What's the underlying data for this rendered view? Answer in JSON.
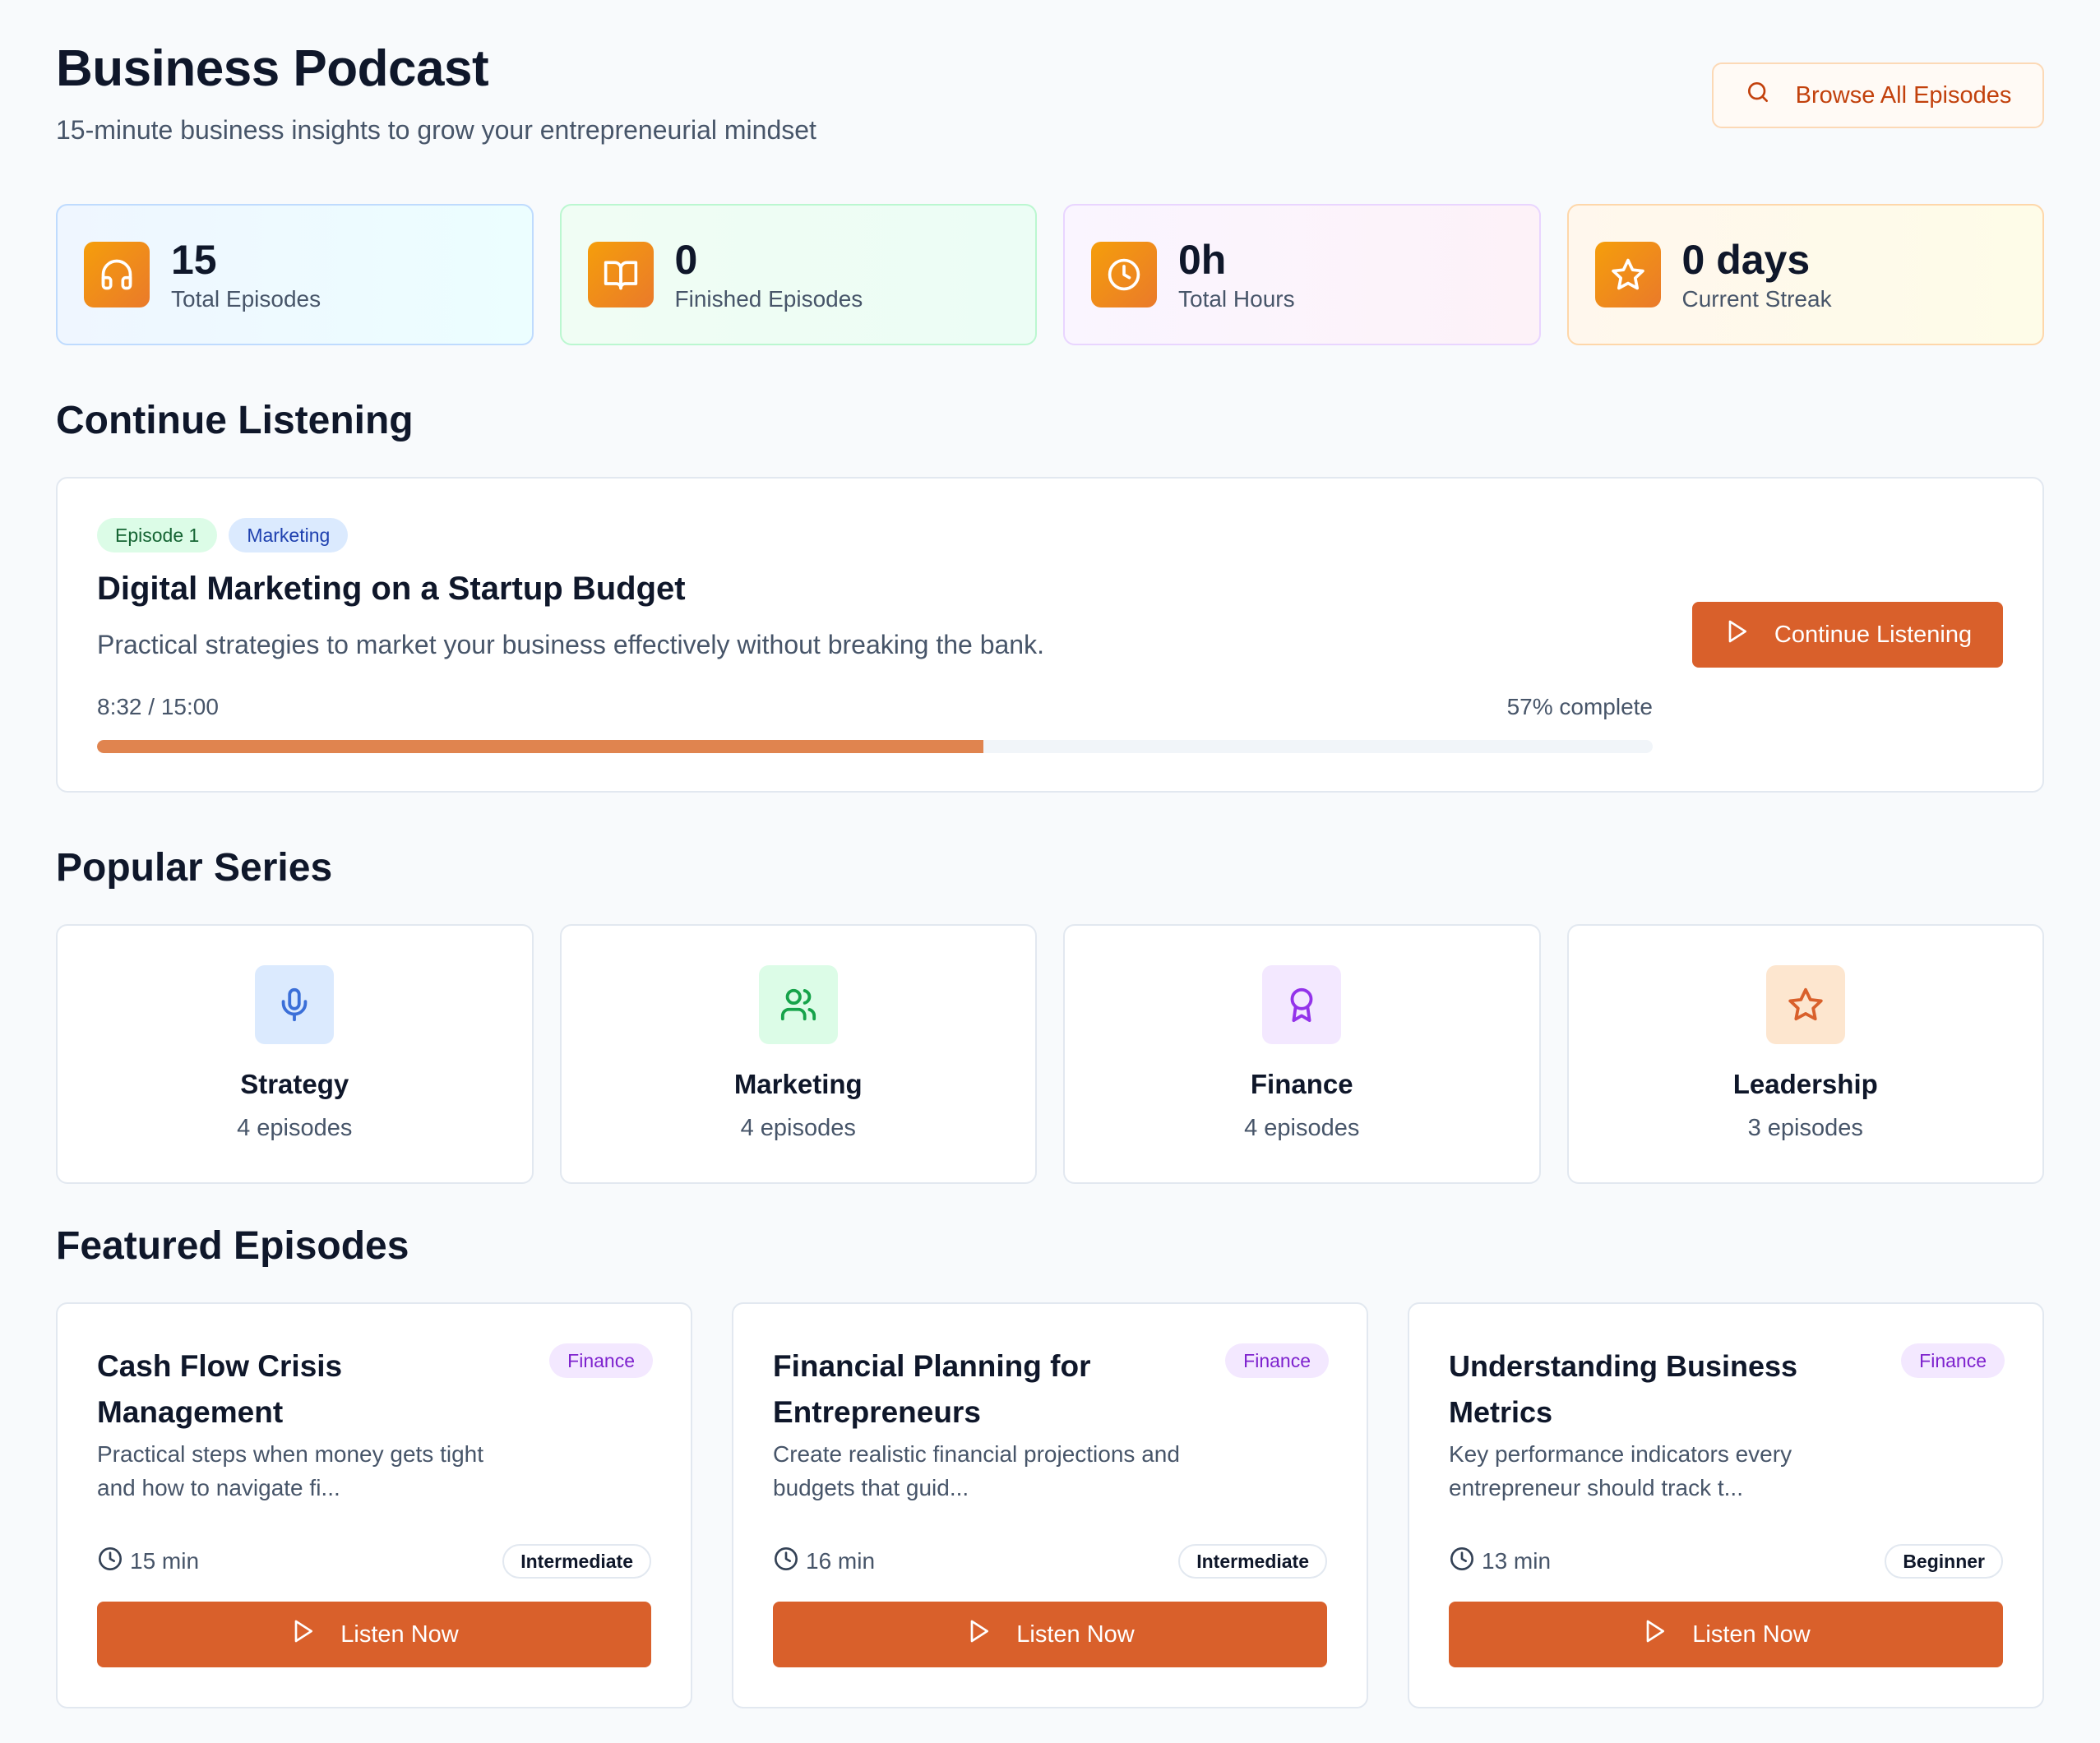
{
  "header": {
    "title": "Business Podcast",
    "subtitle": "15-minute business insights to grow your entrepreneurial mindset",
    "browse_label": "Browse All Episodes"
  },
  "stats": [
    {
      "value": "15",
      "label": "Total Episodes",
      "icon": "headphones-icon"
    },
    {
      "value": "0",
      "label": "Finished Episodes",
      "icon": "book-open-icon"
    },
    {
      "value": "0h",
      "label": "Total Hours",
      "icon": "clock-icon"
    },
    {
      "value": "0 days",
      "label": "Current Streak",
      "icon": "star-icon"
    }
  ],
  "continue_listening": {
    "section_title": "Continue Listening",
    "episode_tag": "Episode 1",
    "category_tag": "Marketing",
    "title": "Digital Marketing on a Startup Budget",
    "description": "Practical strategies to market your business effectively without breaking the bank.",
    "time": "8:32 / 15:00",
    "percent_text": "57% complete",
    "progress": 0.57,
    "button_label": "Continue Listening"
  },
  "popular_series": {
    "section_title": "Popular Series",
    "items": [
      {
        "name": "Strategy",
        "count": "4 episodes",
        "icon": "microphone-icon"
      },
      {
        "name": "Marketing",
        "count": "4 episodes",
        "icon": "users-icon"
      },
      {
        "name": "Finance",
        "count": "4 episodes",
        "icon": "award-icon"
      },
      {
        "name": "Leadership",
        "count": "3 episodes",
        "icon": "star-icon"
      }
    ]
  },
  "featured": {
    "section_title": "Featured Episodes",
    "episodes": [
      {
        "title": "Cash Flow Crisis Management",
        "category": "Finance",
        "description": "Practical steps when money gets tight and how to navigate fi...",
        "duration": "15 min",
        "level": "Intermediate",
        "button_label": "Listen Now"
      },
      {
        "title": "Financial Planning for Entrepreneurs",
        "category": "Finance",
        "description": "Create realistic financial projections and budgets that guid...",
        "duration": "16 min",
        "level": "Intermediate",
        "button_label": "Listen Now"
      },
      {
        "title": "Understanding Business Metrics",
        "category": "Finance",
        "description": "Key performance indicators every entrepreneur should track t...",
        "duration": "13 min",
        "level": "Beginner",
        "button_label": "Listen Now"
      }
    ]
  },
  "colors": {
    "accent": "#d9602b",
    "stat_icon_gradient": [
      "#f59e0b",
      "#ea7a2a"
    ],
    "progress_fill": "#e0844f"
  }
}
